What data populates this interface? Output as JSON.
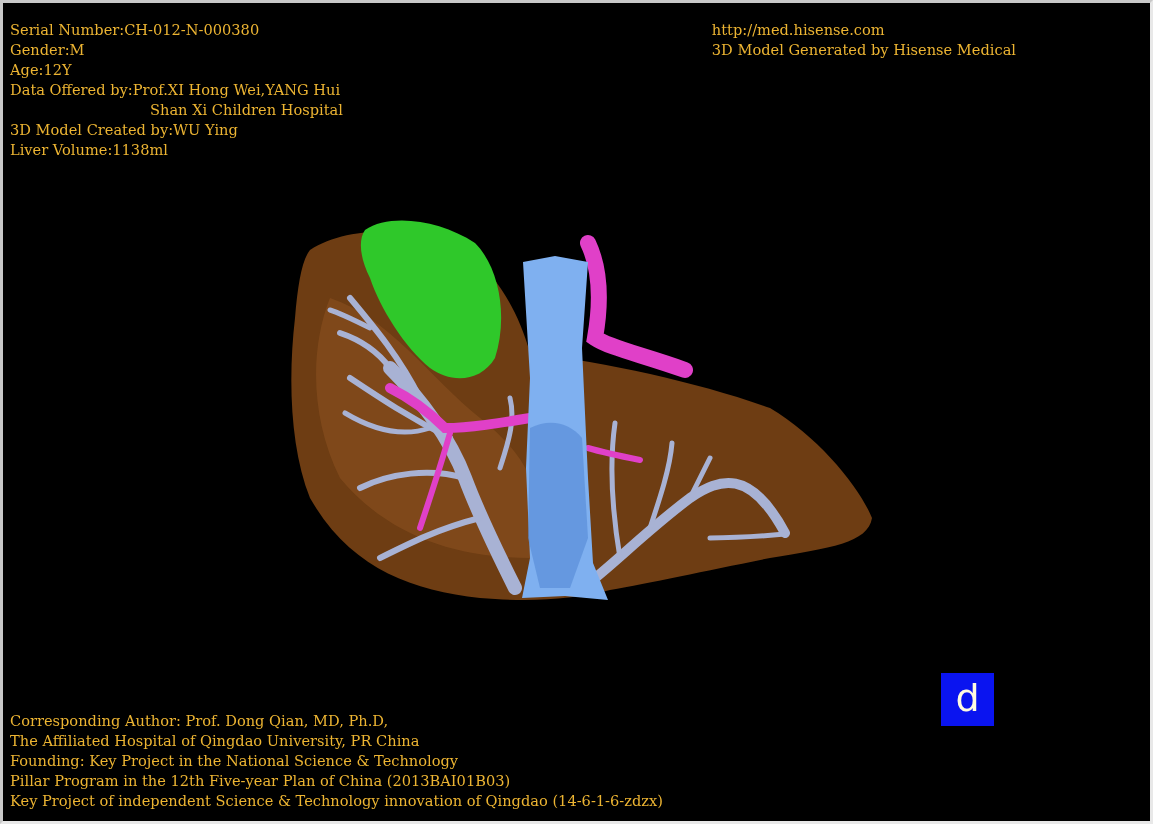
{
  "info_left": [
    {
      "kind": "line",
      "text": "Serial Number:CH-012-N-000380"
    },
    {
      "kind": "line",
      "text": "Gender:M"
    },
    {
      "kind": "line",
      "text": "Age:12Y"
    },
    {
      "kind": "line",
      "text": "Data Offered by:Prof.XI Hong Wei,YANG Hui"
    },
    {
      "kind": "continuation",
      "text": "Shan Xi Children Hospital"
    },
    {
      "kind": "line",
      "text": "3D Model Created by:WU Ying"
    },
    {
      "kind": "line",
      "text": "Liver Volume:1138ml"
    }
  ],
  "info_right": [
    "http://med.hisense.com",
    "3D Model Generated by Hisense Medical"
  ],
  "credits": [
    "Corresponding Author: Prof. Dong Qian, MD, Ph.D,",
    "The Affiliated Hospital of Qingdao University, PR China",
    "Founding: Key Project in the National Science & Technology",
    "Pillar Program in the 12th Five-year Plan of China (2013BAI01B03)",
    "Key Project of independent Science & Technology innovation of Qingdao (14-6-1-6-zdzx)"
  ],
  "view_badge": {
    "label": "d"
  }
}
